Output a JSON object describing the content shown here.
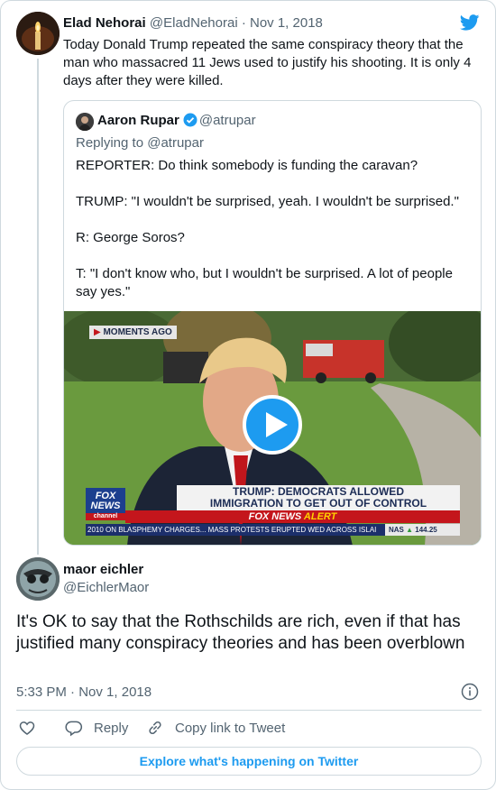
{
  "parent_tweet": {
    "author_name": "Elad Nehorai",
    "author_handle": "@EladNehorai",
    "separator": "·",
    "date": "Nov 1, 2018",
    "text": "Today Donald Trump repeated the same conspiracy theory that the man who massacred 11 Jews used to justify his shooting. It is only 4 days after they were killed."
  },
  "quoted_tweet": {
    "author_name": "Aaron Rupar",
    "author_handle": "@atrupar",
    "replying_prefix": "Replying to",
    "replying_to": "@atrupar",
    "lines": [
      "REPORTER: Do think somebody is funding the caravan?",
      "TRUMP: \"I wouldn't be surprised, yeah. I wouldn't be surprised.\"",
      "R: George Soros?",
      "T: \"I don't know who, but I wouldn't be surprised. A lot of people say yes.\""
    ],
    "video": {
      "moments_badge": "MOMENTS AGO",
      "headline_line1": "TRUMP: DEMOCRATS ALLOWED",
      "headline_line2": "IMMIGRATION TO GET OUT OF CONTROL",
      "alert_prefix": "FOX NEWS",
      "alert_word": "ALERT",
      "logo_line1": "FOX",
      "logo_line2": "NEWS",
      "logo_channel": "channel",
      "ticker": "2010 ON BLASPHEMY CHARGES...  MASS PROTESTS ERUPTED WED ACROSS ISLAI",
      "index_name": "NAS",
      "index_value": "144.25"
    }
  },
  "reply_tweet": {
    "author_name": "maor eichler",
    "author_handle": "@EichlerMaor",
    "text": "It's OK to say that the Rothschilds are rich, even if that has justified many conspiracy theories and has been overblown",
    "time": "5:33 PM",
    "separator": "·",
    "date": "Nov 1, 2018"
  },
  "actions": {
    "reply_label": "Reply",
    "copy_link_label": "Copy link to Tweet"
  },
  "explore_label": "Explore what's happening on Twitter",
  "colors": {
    "twitter_blue": "#1d9bf0",
    "text_primary": "#0f1419",
    "text_secondary": "#536471",
    "border": "#cfd9de",
    "fox_red": "#c4161c",
    "fox_navy": "#1c2c55"
  },
  "icons": [
    "twitter-bird-icon",
    "verified-badge-icon",
    "play-icon",
    "info-icon",
    "heart-icon",
    "reply-icon",
    "copy-link-icon"
  ]
}
